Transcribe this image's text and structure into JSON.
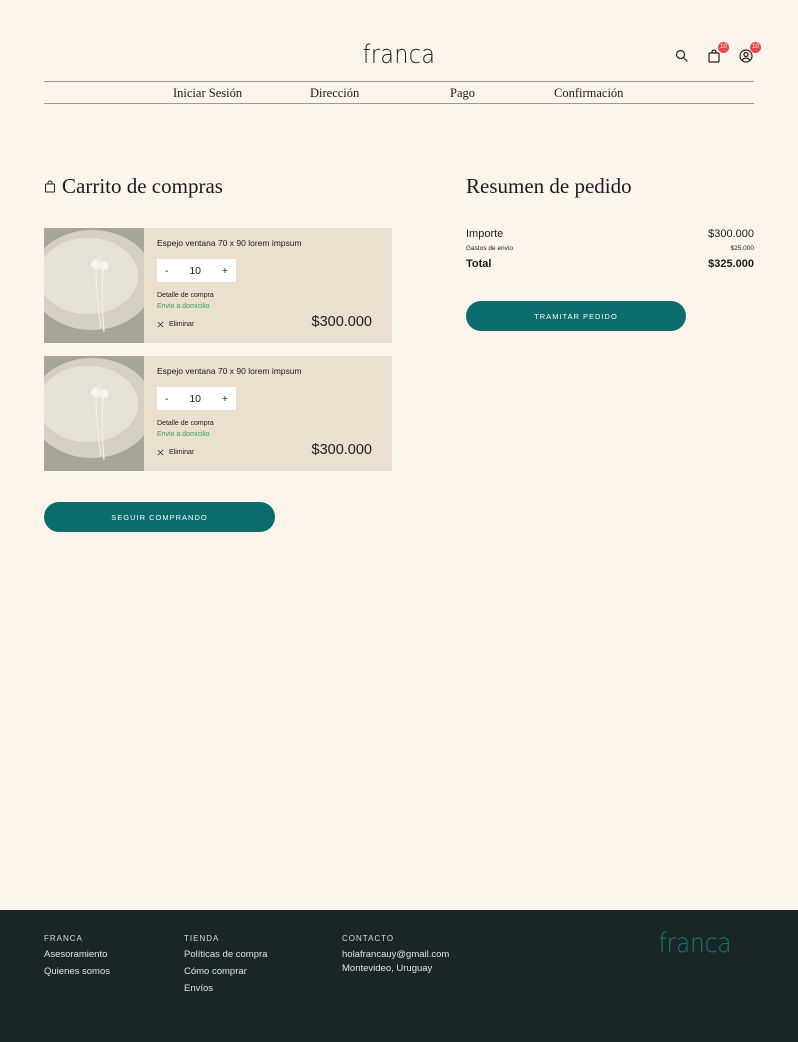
{
  "brand": {
    "logo": "franca"
  },
  "header": {
    "icons": [
      {
        "name": "search-icon"
      },
      {
        "name": "bag-icon",
        "badge": "10"
      },
      {
        "name": "user-icon",
        "badge": "10"
      }
    ]
  },
  "steps": [
    "Iniciar Sesión",
    "Dirección",
    "Pago",
    "Confirmación"
  ],
  "cart": {
    "title": "Carrito de compras",
    "items": [
      {
        "name": "Espejo ventana 70 x 90 lorem impsum",
        "qty_minus": "-",
        "qty": "10",
        "qty_plus": "+",
        "detail": "Detalle de compra",
        "shipping": "Envio a domicilio",
        "remove": "Eliminar",
        "price": "$300.000"
      },
      {
        "name": "Espejo ventana 70 x 90 lorem impsum",
        "qty_minus": "-",
        "qty": "10",
        "qty_plus": "+",
        "detail": "Detalle de compra",
        "shipping": "Envio a domicilio",
        "remove": "Eliminar",
        "price": "$300.000"
      }
    ],
    "continue_button": "SEGUIR COMPRANDO"
  },
  "summary": {
    "title": "Resumen de pedido",
    "amount_label": "Importe",
    "amount_value": "$300.000",
    "shipping_label": "Gastos de envio",
    "shipping_value": "$25.000",
    "total_label": "Total",
    "total_value": "$325.000",
    "checkout_button": "TRAMITAR PEDIDO"
  },
  "footer": {
    "col1": {
      "heading": "FRANCA",
      "links": [
        "Asesoramiento",
        "Quienes somos"
      ]
    },
    "col2": {
      "heading": "TIENDA",
      "links": [
        "Políticas de compra",
        "Cómo comprar",
        "Envíos"
      ]
    },
    "col3": {
      "heading": "CONTACTO",
      "lines": [
        "holafrancauy@gmail.com",
        "Montevideo, Uruguay"
      ]
    },
    "logo": "franca"
  },
  "colors": {
    "background": "#fdf5ec",
    "accent": "#0a6c6b",
    "item_background": "#ebdfcf",
    "footer": "#1a2626",
    "shipping_green": "#2f9e57",
    "badge": "#e5484d"
  }
}
